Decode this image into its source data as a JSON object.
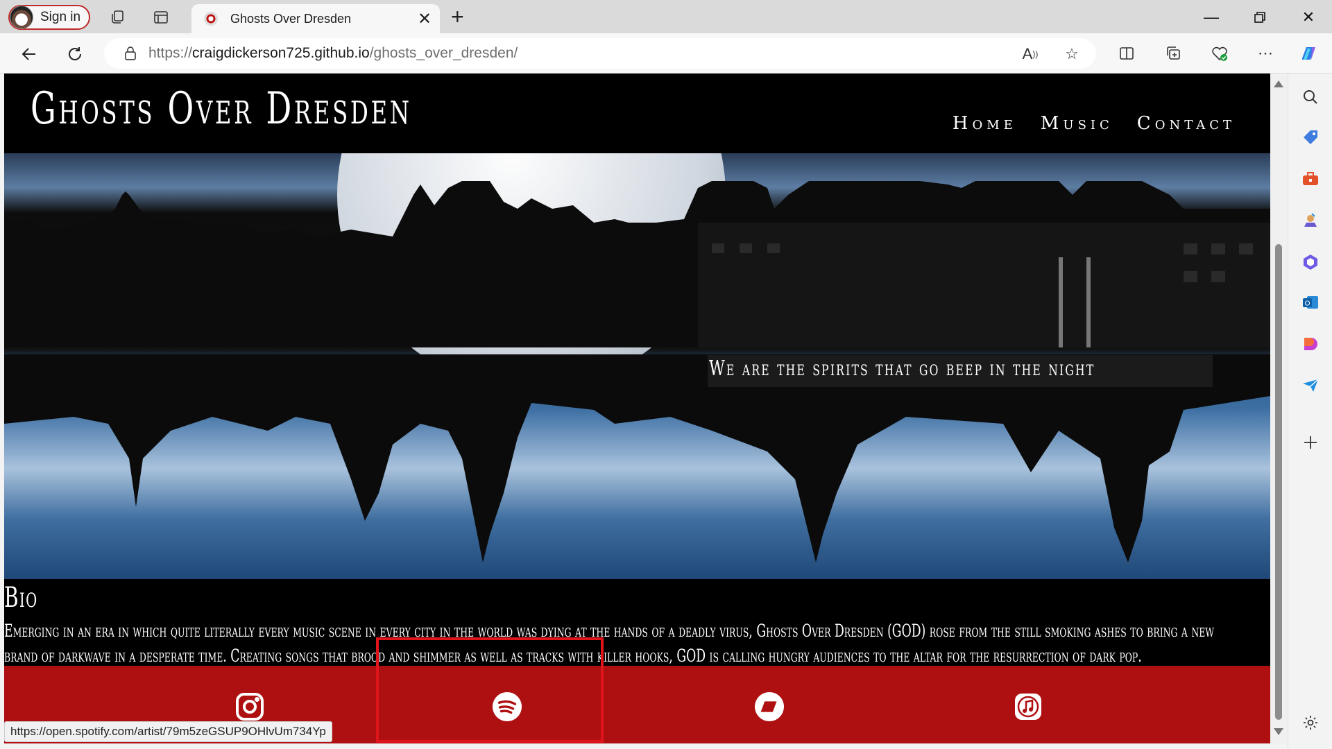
{
  "browser": {
    "signin_label": "Sign in",
    "tab": {
      "title": "Ghosts Over Dresden"
    },
    "address": {
      "url_prefix": "https://",
      "url_domain": "craigdickerson725.github.io",
      "url_path": "/ghosts_over_dresden/"
    },
    "status_url": "https://open.spotify.com/artist/79m5zeGSUP9OHlvUm734Yp"
  },
  "site": {
    "title": "Ghosts Over Dresden",
    "nav": [
      "Home",
      "Music",
      "Contact"
    ],
    "tagline": "We are the spirits that go beep in the night",
    "bio_heading": "Bio",
    "bio_text": "Emerging in an era in which quite literally every music scene in every city in the world was dying at the hands of a deadly virus, Ghosts Over Dresden (GOD) rose from the still smoking ashes to bring a new brand of darkwave in a desperate time. Creating songs that brood and shimmer as well as tracks with killer hooks, GOD is calling hungry audiences to the altar for the resurrection of dark pop.",
    "social": [
      {
        "name": "instagram-icon"
      },
      {
        "name": "spotify-icon"
      },
      {
        "name": "bandcamp-icon"
      },
      {
        "name": "itunes-icon"
      }
    ]
  },
  "colors": {
    "social_bar": "#ae1012",
    "highlight": "#e0151b",
    "header": "#000000"
  }
}
